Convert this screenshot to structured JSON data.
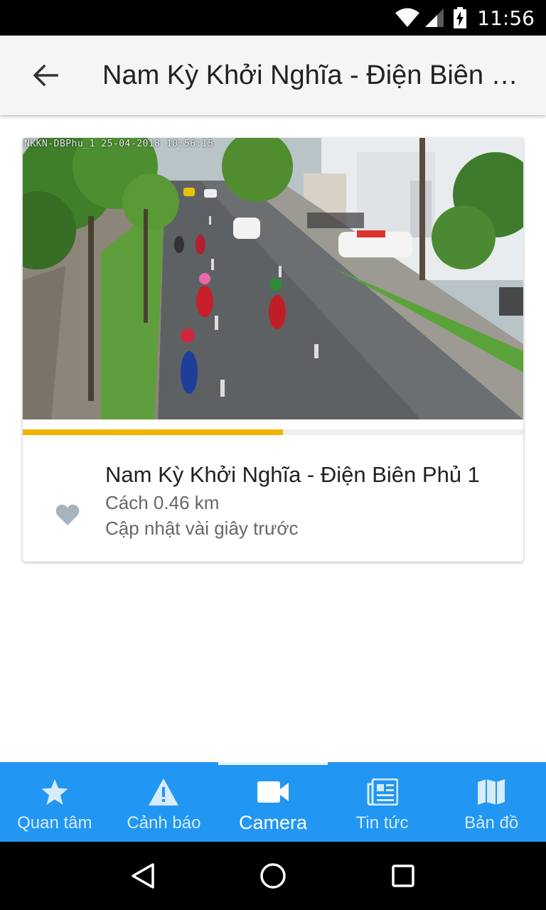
{
  "status_bar": {
    "time": "11:56"
  },
  "app_bar": {
    "title": "Nam Kỳ Khởi Nghĩa - Điện Biên Phủ 1"
  },
  "camera": {
    "overlay_text": "NKKN-DBPhu_1  25-04-2018  10:56:15",
    "name": "Nam Kỳ Khởi Nghĩa - Điện Biên Phủ 1",
    "distance": "Cách 0.46 km",
    "updated": "Cập nhật vài giây trước",
    "refresh_progress": 0.52,
    "favorite_icon": "heart-icon"
  },
  "bottom_nav": {
    "active_index": 2,
    "items": [
      {
        "label": "Quan tâm",
        "icon": "star-icon"
      },
      {
        "label": "Cảnh báo",
        "icon": "warning-icon"
      },
      {
        "label": "Camera",
        "icon": "video-camera-icon"
      },
      {
        "label": "Tin tức",
        "icon": "newspaper-icon"
      },
      {
        "label": "Bản đồ",
        "icon": "map-icon"
      }
    ]
  },
  "colors": {
    "primary": "#2196f3",
    "progress": "#f0b400",
    "app_bar": "#f5f5f5"
  }
}
